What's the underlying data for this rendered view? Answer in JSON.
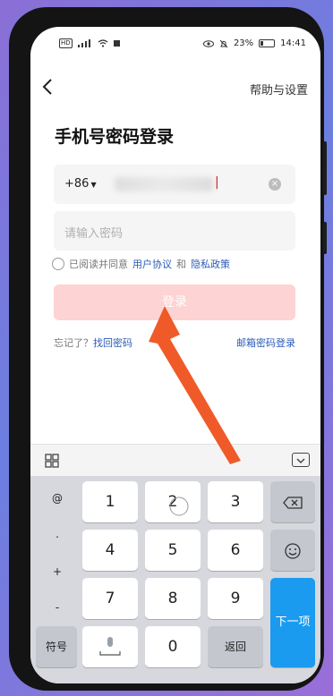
{
  "status_bar": {
    "left_label": "HD",
    "battery": "23%",
    "time": "14:41",
    "battery_fraction": 0.23
  },
  "nav": {
    "help_label": "帮助与设置"
  },
  "page": {
    "title": "手机号密码登录"
  },
  "phone_field": {
    "country_code": "+86",
    "clear_icon": "×"
  },
  "password_field": {
    "placeholder": "请输入密码"
  },
  "agreement": {
    "prefix": "已阅读并同意",
    "user_agreement": "用户协议",
    "and": "和",
    "privacy_policy": "隐私政策"
  },
  "login": {
    "label": "登录"
  },
  "links": {
    "forgot_prefix": "忘记了？",
    "recover_password": "找回密码",
    "email_login": "邮箱密码登录"
  },
  "keyboard": {
    "symbols": [
      "@",
      ".",
      "+",
      "-"
    ],
    "digits": [
      "1",
      "2",
      "3",
      "4",
      "5",
      "6",
      "7",
      "8",
      "9",
      "0"
    ],
    "symbols_key": "符号",
    "return_key": "返回",
    "next_key": "下一项"
  },
  "colors": {
    "accent": "#2b5bb8",
    "login_button": "#fdd3d3",
    "arrow": "#f05a28",
    "next_key": "#1a9bf0"
  }
}
